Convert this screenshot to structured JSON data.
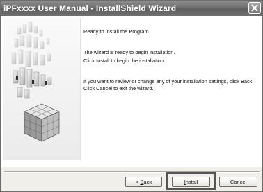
{
  "window": {
    "title": "iPFxxxx User Manual - InstallShield Wizard"
  },
  "content": {
    "heading": "Ready to Install the Program",
    "paragraph1": "The wizard is ready to begin installation.",
    "paragraph2": "Click Install to begin the installation.",
    "paragraph3": "If you want to review or change any of your installation settings, click Back. Click Cancel to exit the wizard."
  },
  "buttons": {
    "back_prefix": "< ",
    "back_mnemonic": "B",
    "back_rest": "ack",
    "install_mnemonic": "I",
    "install_rest": "nstall",
    "cancel": "Cancel"
  },
  "colors": {
    "titlebar": "#6e6e6e",
    "highlight_box": "#555555"
  },
  "icons": {
    "close": "close-icon",
    "illustration": "3d-cube-blocks"
  }
}
